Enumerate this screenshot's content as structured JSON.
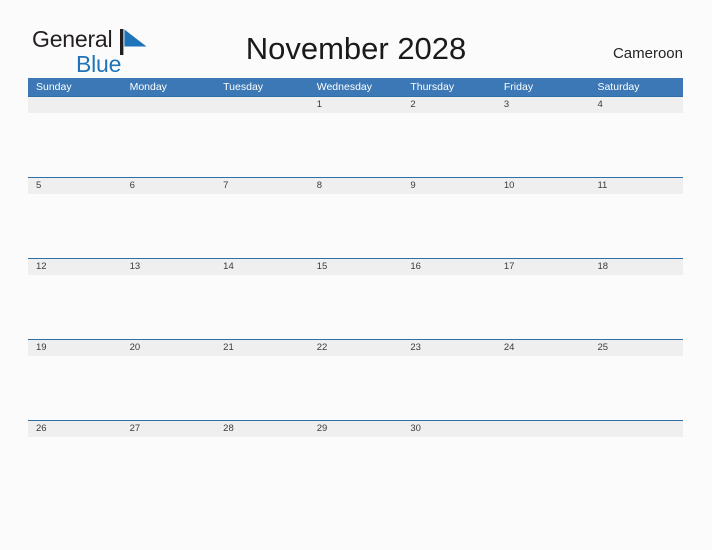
{
  "brand": {
    "word_one": "General",
    "word_two": "Blue",
    "flag_icon": "flag-triangle-icon",
    "color_dark": "#231f20",
    "color_blue": "#1f73b8"
  },
  "header": {
    "title": "November 2028",
    "locale": "Cameroon"
  },
  "calendar": {
    "accent_color": "#3b78b5",
    "row_band_color": "#efefef",
    "weekdays": [
      "Sunday",
      "Monday",
      "Tuesday",
      "Wednesday",
      "Thursday",
      "Friday",
      "Saturday"
    ],
    "weeks": [
      {
        "days": [
          "",
          "",
          "",
          "1",
          "2",
          "3",
          "4"
        ]
      },
      {
        "days": [
          "5",
          "6",
          "7",
          "8",
          "9",
          "10",
          "11"
        ]
      },
      {
        "days": [
          "12",
          "13",
          "14",
          "15",
          "16",
          "17",
          "18"
        ]
      },
      {
        "days": [
          "19",
          "20",
          "21",
          "22",
          "23",
          "24",
          "25"
        ]
      },
      {
        "days": [
          "26",
          "27",
          "28",
          "29",
          "30",
          "",
          ""
        ]
      }
    ]
  }
}
